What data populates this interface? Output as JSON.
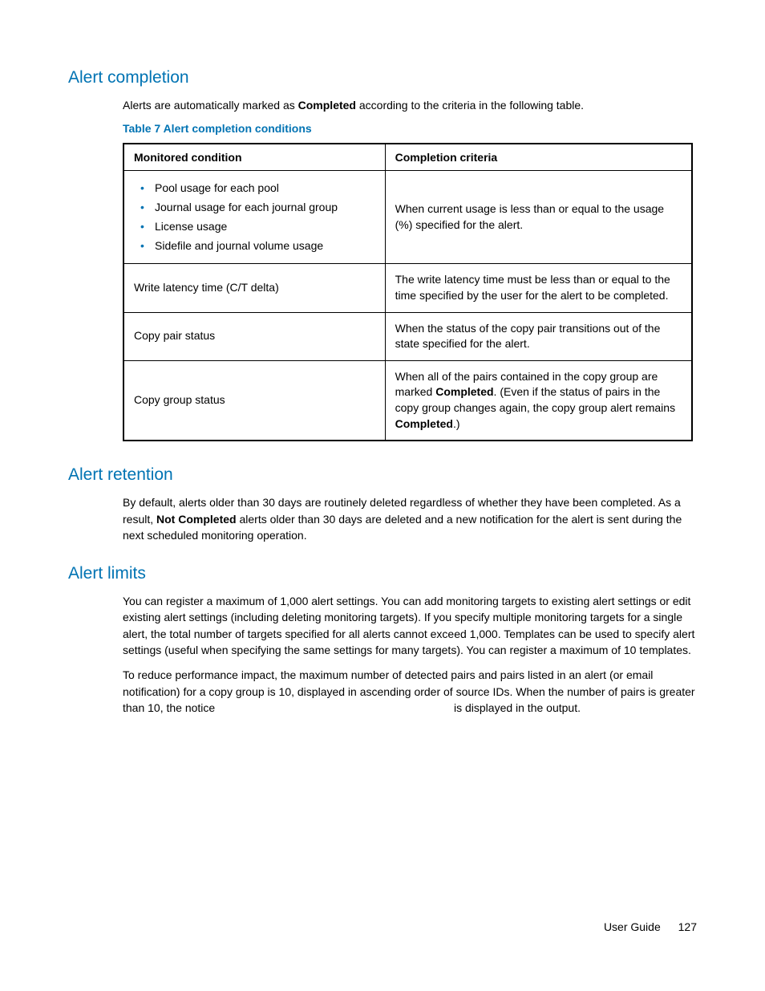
{
  "sections": {
    "completion": {
      "heading": "Alert completion",
      "intro_before": "Alerts are automatically marked as ",
      "intro_bold": "Completed",
      "intro_after": " according to the criteria in the following table.",
      "table_caption": "Table 7 Alert completion conditions",
      "table": {
        "header_left": "Monitored condition",
        "header_right": "Completion criteria",
        "rows": {
          "r1": {
            "bullets": {
              "b1": "Pool usage for each pool",
              "b2": "Journal usage for each journal group",
              "b3": "License usage",
              "b4": "Sidefile and journal volume usage"
            },
            "right": "When current usage is less than or equal to the usage (%) specified for the alert."
          },
          "r2": {
            "left": "Write latency time (C/T delta)",
            "right": "The write latency time must be less than or equal to the time specified by the user for the alert to be completed."
          },
          "r3": {
            "left": "Copy pair status",
            "right": "When the status of the copy pair transitions out of the state specified for the alert."
          },
          "r4": {
            "left": "Copy group status",
            "right_a": "When all of the pairs contained in the copy group are marked ",
            "right_bold1": "Completed",
            "right_b": ". (Even if the status of pairs in the copy group changes again, the copy group alert remains ",
            "right_bold2": "Completed",
            "right_c": ".)"
          }
        }
      }
    },
    "retention": {
      "heading": "Alert retention",
      "text_a": "By default, alerts older than 30 days are routinely deleted regardless of whether they have been completed. As a result, ",
      "text_bold": "Not Completed",
      "text_b": " alerts older than 30 days are deleted and a new notification for the alert is sent during the next scheduled monitoring operation."
    },
    "limits": {
      "heading": "Alert limits",
      "p1": "You can register a maximum of 1,000 alert settings. You can add monitoring targets to existing alert settings or edit existing alert settings (including deleting monitoring targets). If you specify multiple monitoring targets for a single alert, the total number of targets specified for all alerts cannot exceed 1,000. Templates can be used to specify alert settings (useful when specifying the same settings for many targets). You can register a maximum of 10 templates.",
      "p2": "To reduce performance impact, the maximum number of detected pairs and pairs listed in an alert (or email notification) for a copy group is 10, displayed in ascending order of source IDs. When the number of pairs is greater than 10, the notice",
      "p2_tail": "is displayed in the output."
    }
  },
  "footer": {
    "label": "User Guide",
    "page": "127"
  }
}
